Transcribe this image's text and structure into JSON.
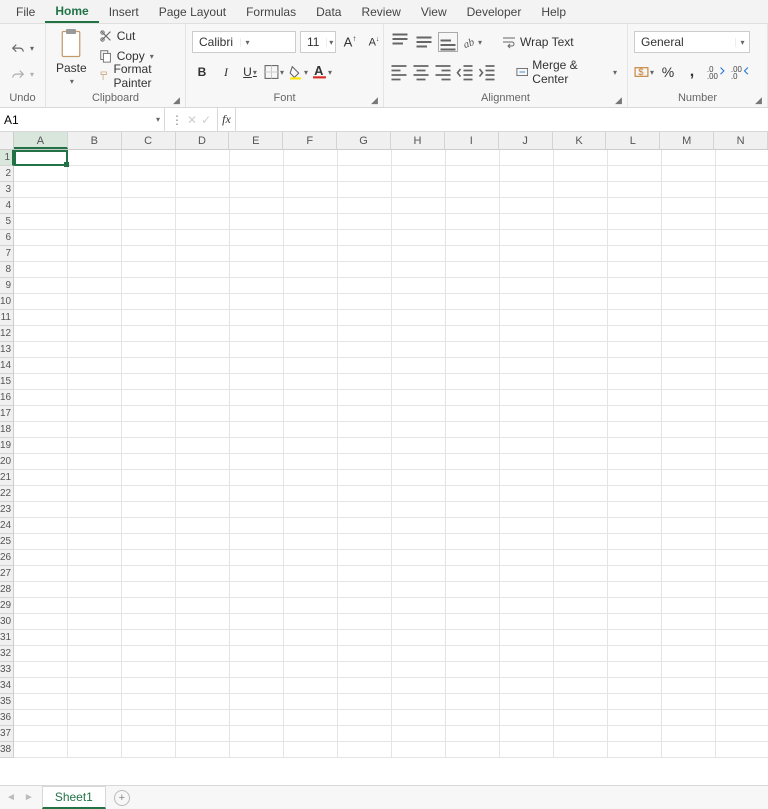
{
  "tabs": {
    "file": "File",
    "home": "Home",
    "insert": "Insert",
    "pagelayout": "Page Layout",
    "formulas": "Formulas",
    "data": "Data",
    "review": "Review",
    "view": "View",
    "developer": "Developer",
    "help": "Help"
  },
  "clipboard": {
    "cut": "Cut",
    "copy": "Copy",
    "paint": "Format Painter",
    "paste": "Paste",
    "label": "Clipboard"
  },
  "undo": {
    "label": "Undo"
  },
  "font": {
    "name": "Calibri",
    "size": "11",
    "label": "Font"
  },
  "align": {
    "wrap": "Wrap Text",
    "merge": "Merge & Center",
    "label": "Alignment"
  },
  "number": {
    "format": "General",
    "label": "Number"
  },
  "fbar": {
    "cellref": "A1",
    "fx": "fx"
  },
  "columns": [
    "A",
    "B",
    "C",
    "D",
    "E",
    "F",
    "G",
    "H",
    "I",
    "J",
    "K",
    "L",
    "M",
    "N"
  ],
  "rows": [
    "1",
    "2",
    "3",
    "4",
    "5",
    "6",
    "7",
    "8",
    "9",
    "10",
    "11",
    "12",
    "13",
    "14",
    "15",
    "16",
    "17",
    "18",
    "19",
    "20",
    "21",
    "22",
    "23",
    "24",
    "25",
    "26",
    "27",
    "28",
    "29",
    "30",
    "31",
    "32",
    "33",
    "34",
    "35",
    "36",
    "37",
    "38"
  ],
  "sheet": {
    "name": "Sheet1"
  }
}
